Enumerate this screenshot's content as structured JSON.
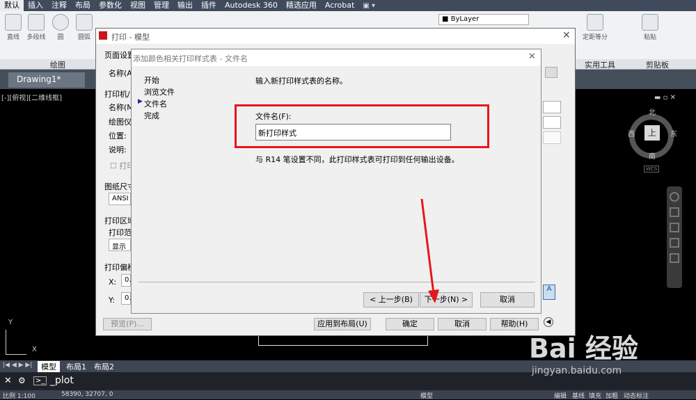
{
  "menubar": {
    "tabs": [
      "默认",
      "插入",
      "注释",
      "布局",
      "参数化",
      "视图",
      "管理",
      "输出",
      "插件",
      "Autodesk 360",
      "精选应用",
      "Acrobat"
    ],
    "bylayer": "ByLayer"
  },
  "ribbon": {
    "tools": [
      "直线",
      "多段线",
      "圆",
      "圆弧",
      "定距等分",
      "粘贴"
    ],
    "panels": [
      "绘图",
      "实用工具",
      "剪贴板"
    ]
  },
  "doc": {
    "tab": "Drawing1*"
  },
  "viewport": {
    "label": "[-][俯视][二维线框]"
  },
  "viewcube": {
    "north": "北",
    "south": "南",
    "east": "东",
    "west": "西",
    "top": "上",
    "wcs": "WCS"
  },
  "ucs": {
    "x": "X",
    "y": "Y"
  },
  "layout_tabs": [
    "模型",
    "布局1",
    "布局2"
  ],
  "command": {
    "text": "_plot"
  },
  "status": {
    "scale": "比例 1:100",
    "coords": "58390, 32707, 0",
    "right": [
      "模型",
      "编辑",
      "基线",
      "填充",
      "加粗",
      "动态标注"
    ]
  },
  "print_dialog": {
    "title": "打印 - 模型",
    "page_setup": "页面设置",
    "name_label": "名称(A):",
    "printer_section": "打印机/",
    "printer_name": "名称(M)",
    "plotter": "绘图仪",
    "location": "位置:",
    "description": "说明:",
    "print_to_file": "打印",
    "paper_size": "图纸尺寸",
    "paper_value": "ANSI",
    "plot_area": "打印区域",
    "plot_range": "打印范",
    "plot_range_value": "显示",
    "plot_offset": "打印偏移",
    "x_label": "X:",
    "x_value": "0.",
    "y_label": "Y:",
    "y_value": "0.",
    "preview": "预览(P)...",
    "apply_layout": "应用到布局(U)",
    "ok": "确定",
    "cancel": "取消",
    "help": "帮助(H)"
  },
  "wizard": {
    "title": "添加颜色相关打印样式表 - 文件名",
    "steps": [
      "开始",
      "浏览文件",
      "文件名",
      "完成"
    ],
    "current_step": 2,
    "prompt": "输入新打印样式表的名称。",
    "file_label": "文件名(F):",
    "file_value": "新打印样式",
    "note": "与 R14 笔设置不同，此打印样式表可打印到任何输出设备。",
    "back": "< 上一步(B)",
    "next": "下一步(N) >",
    "cancel": "取消"
  },
  "watermark": {
    "brand": "Bai 经验",
    "url": "jingyan.baidu.com"
  },
  "colors": {
    "highlight": "#e8141c",
    "dark_ui": "#3f4b5c",
    "dialog_bg": "#f0f0f0"
  }
}
